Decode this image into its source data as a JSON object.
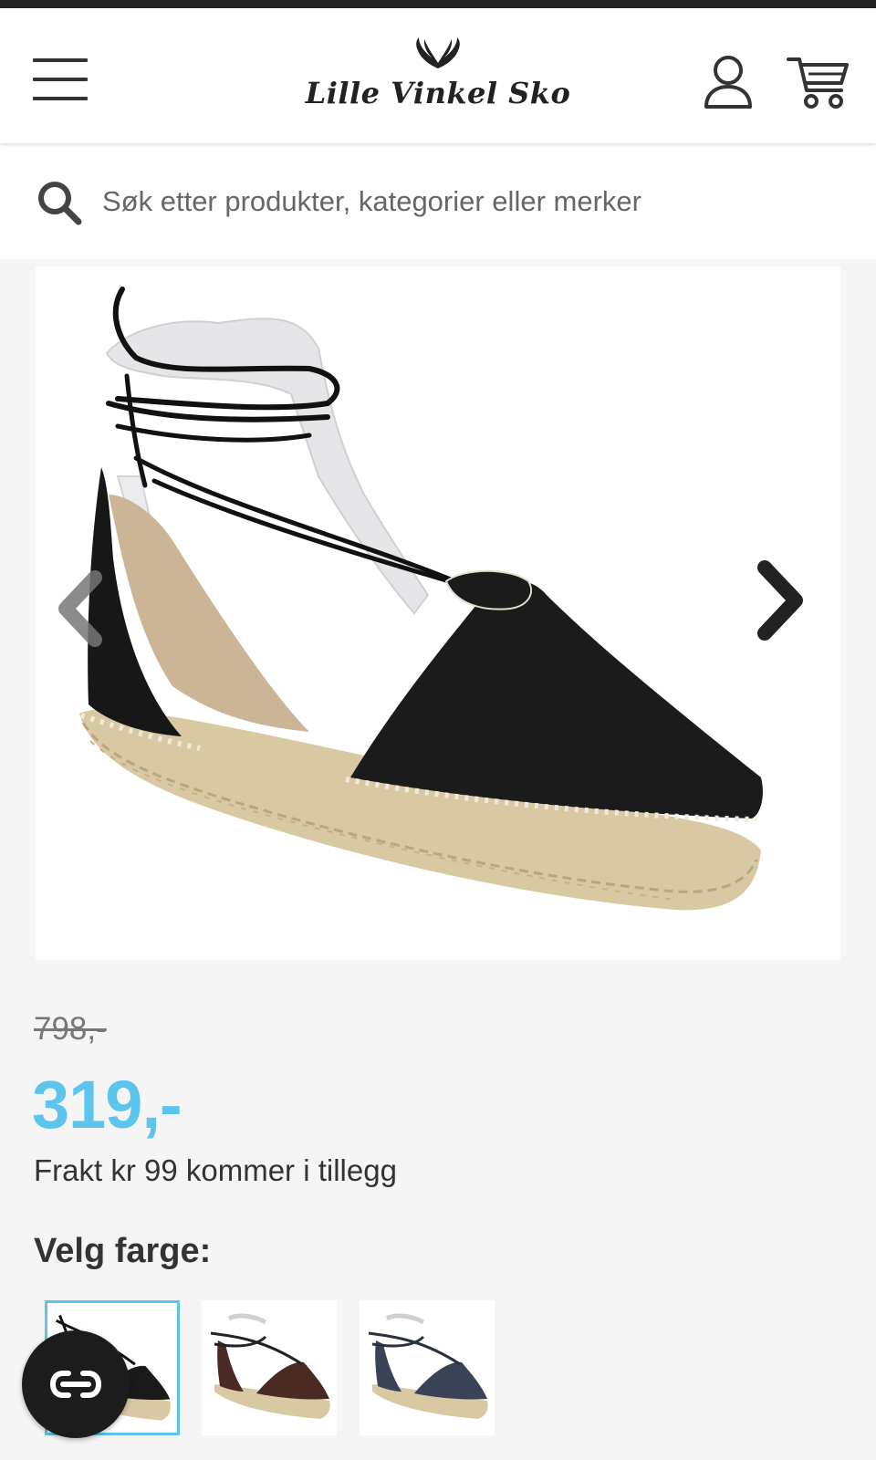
{
  "header": {
    "brand": "Lille Vinkel Sko"
  },
  "search": {
    "placeholder": "Søk etter produkter, kategorier eller merker"
  },
  "product": {
    "old_price": "798,-",
    "price": "319,-",
    "shipping_note": "Frakt kr 99 kommer i tillegg",
    "color_label": "Velg farge:",
    "color_options": [
      {
        "color": "#1a1a1a",
        "selected": true
      },
      {
        "color": "#4a2a22",
        "selected": false
      },
      {
        "color": "#3a4256",
        "selected": false
      }
    ]
  },
  "colors": {
    "accent": "#5bc5ee",
    "header_bg": "#ffffff",
    "page_bg": "#f5f5f5"
  },
  "icons": {
    "menu": "hamburger-icon",
    "account": "user-icon",
    "cart": "cart-icon",
    "search": "search-icon",
    "prev": "chevron-left-icon",
    "next": "chevron-right-icon",
    "chat": "chat-icon"
  }
}
